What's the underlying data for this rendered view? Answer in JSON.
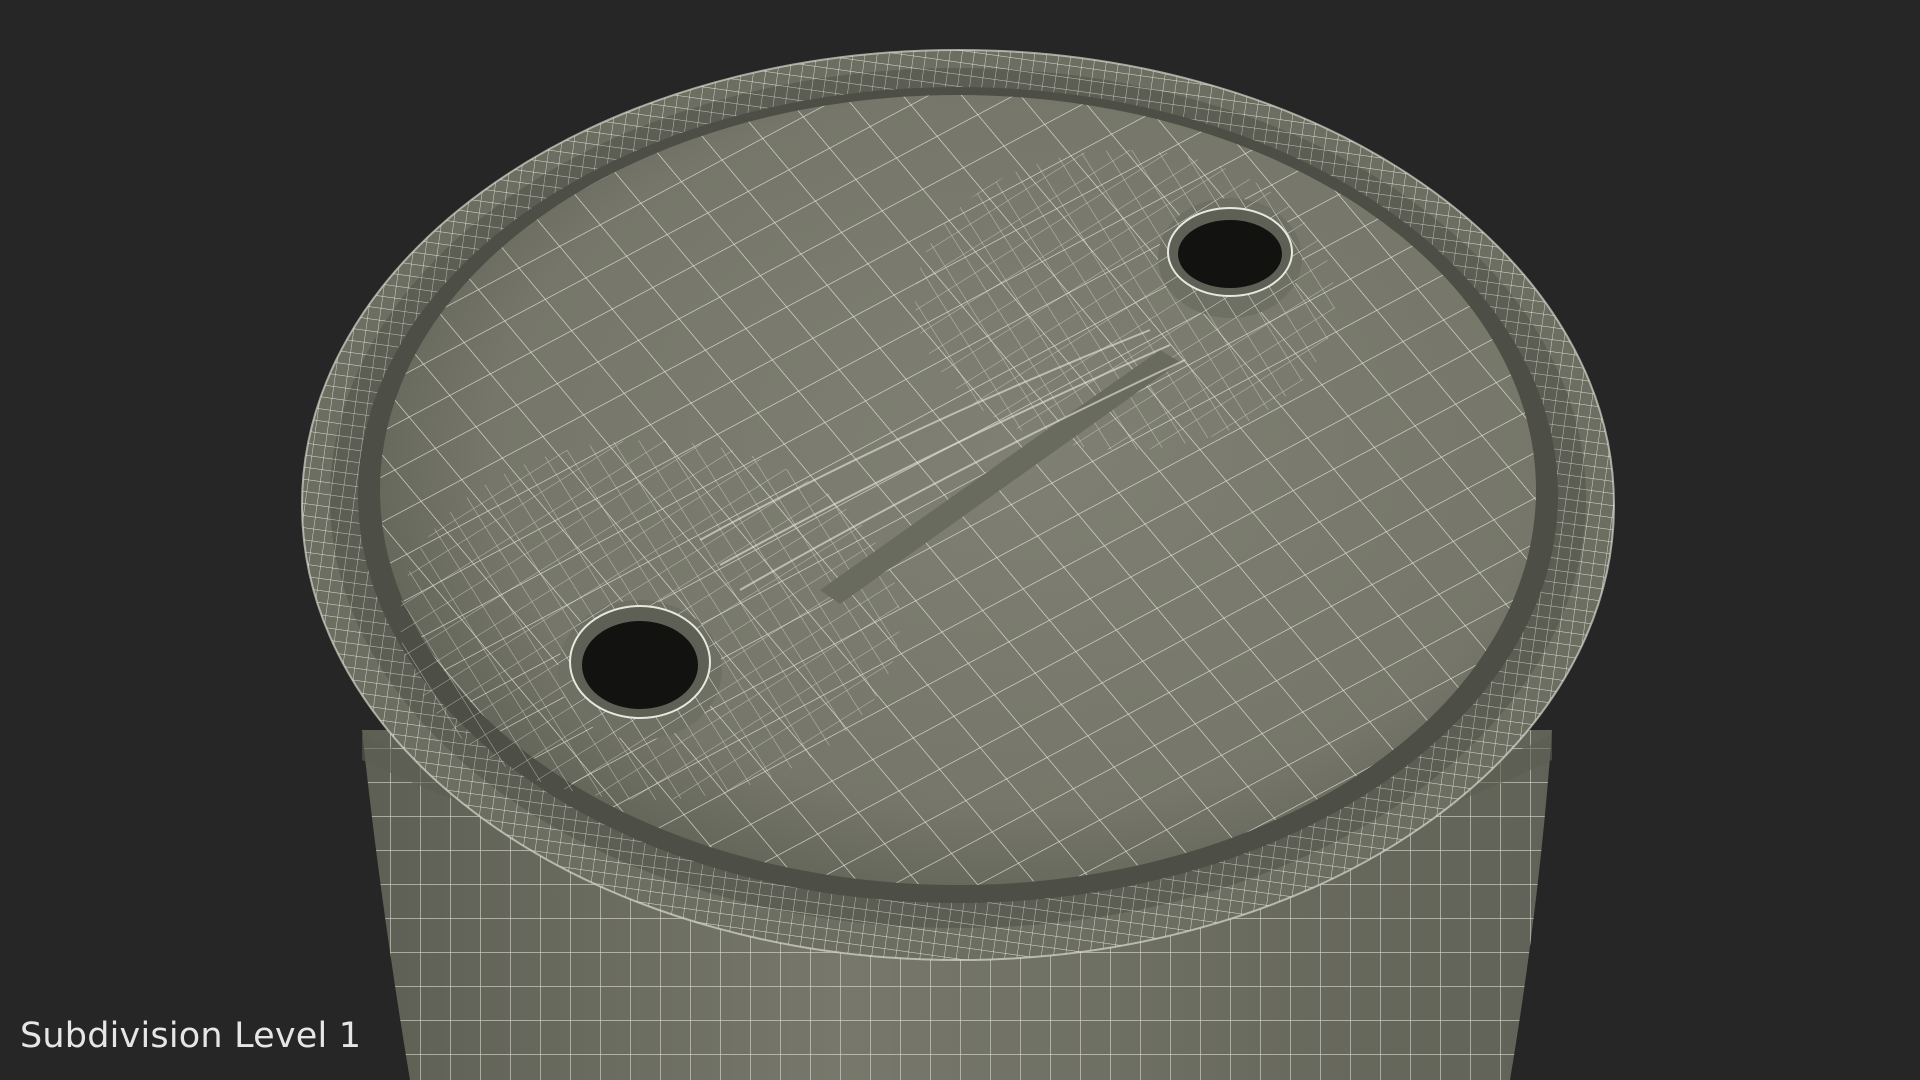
{
  "viewport": {
    "caption": "Subdivision Level 1"
  },
  "scene": {
    "background_color": "#262626",
    "mesh_surface_color": "#7b7c6f",
    "mesh_wire_color": "#e9e8df",
    "hole_color": "#121210",
    "object": "wireframe-barrel-top"
  }
}
